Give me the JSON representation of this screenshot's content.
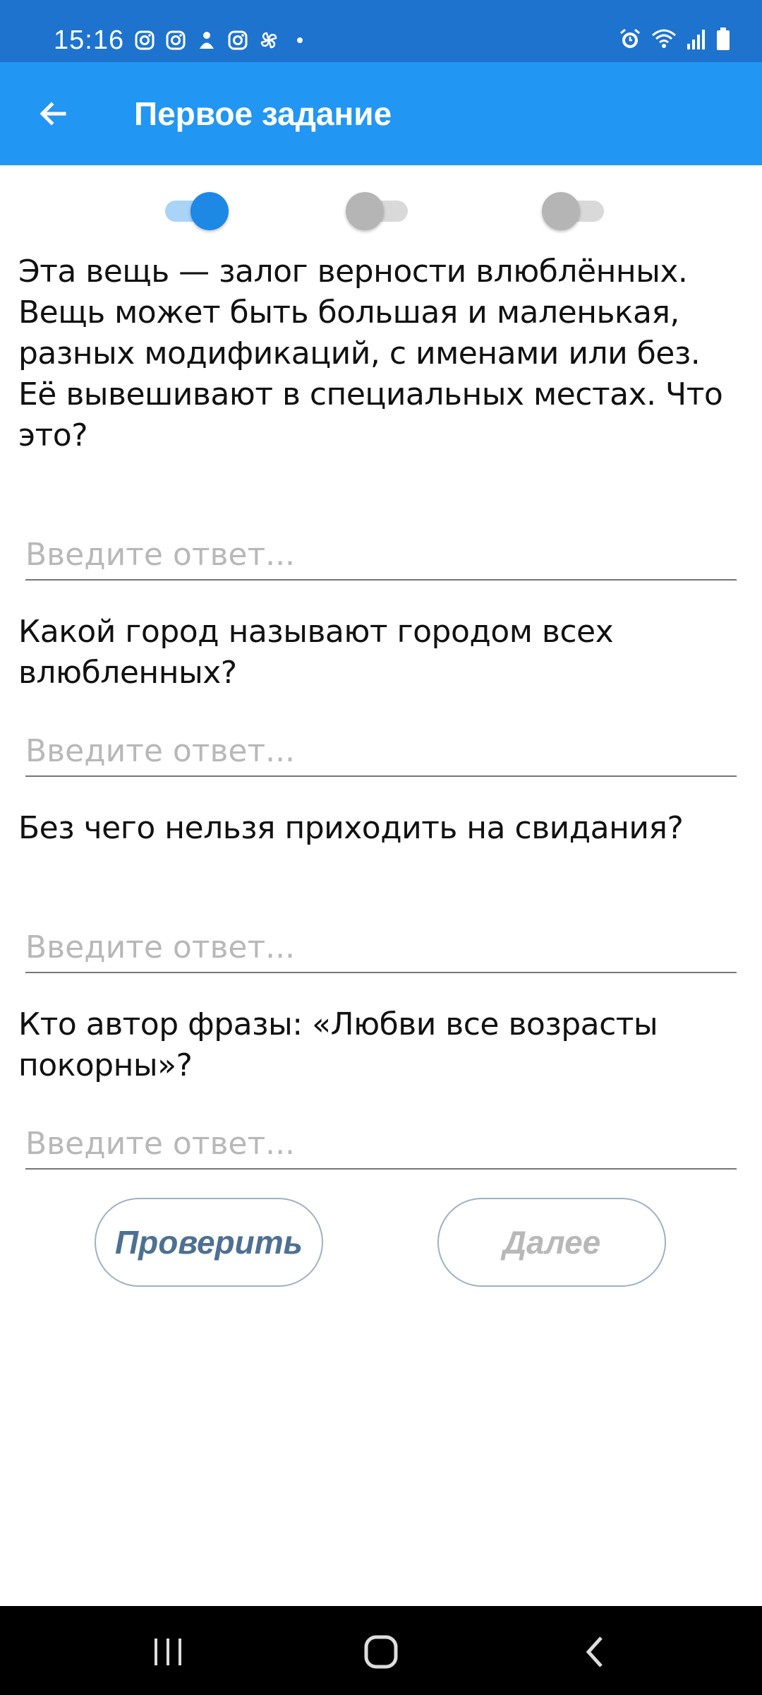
{
  "status_bar": {
    "time": "15:16",
    "app_icons": [
      "instagram-icon",
      "instagram-icon",
      "app-icon",
      "instagram-icon",
      "pinwheel-icon"
    ],
    "right_icons": [
      "alarm-icon",
      "wifi-icon",
      "signal-icon",
      "battery-icon"
    ]
  },
  "app_bar": {
    "title": "Первое задание",
    "background": "#2196f3"
  },
  "progress_toggles": [
    {
      "state": "on"
    },
    {
      "state": "off"
    },
    {
      "state": "off"
    }
  ],
  "questions": [
    {
      "text": "Эта вещь — залог верности влюблённых. Вещь может быть большая и маленькая, разных модификаций, с именами или без. Её вывешивают в специальных местах. Что это?",
      "placeholder": "Введите ответ..."
    },
    {
      "text": "Какой город называют городом всех влюбленных?",
      "placeholder": "Введите ответ..."
    },
    {
      "text": "Без чего нельзя приходить на свидания?",
      "placeholder": "Введите ответ..."
    },
    {
      "text": "Кто автор фразы: «Любви все возрасты покорны»?",
      "placeholder": "Введите ответ..."
    }
  ],
  "buttons": {
    "check_label": "Проверить",
    "next_label": "Далее"
  },
  "nav_bar": {
    "items": [
      "recents-icon",
      "home-icon",
      "back-icon"
    ]
  }
}
